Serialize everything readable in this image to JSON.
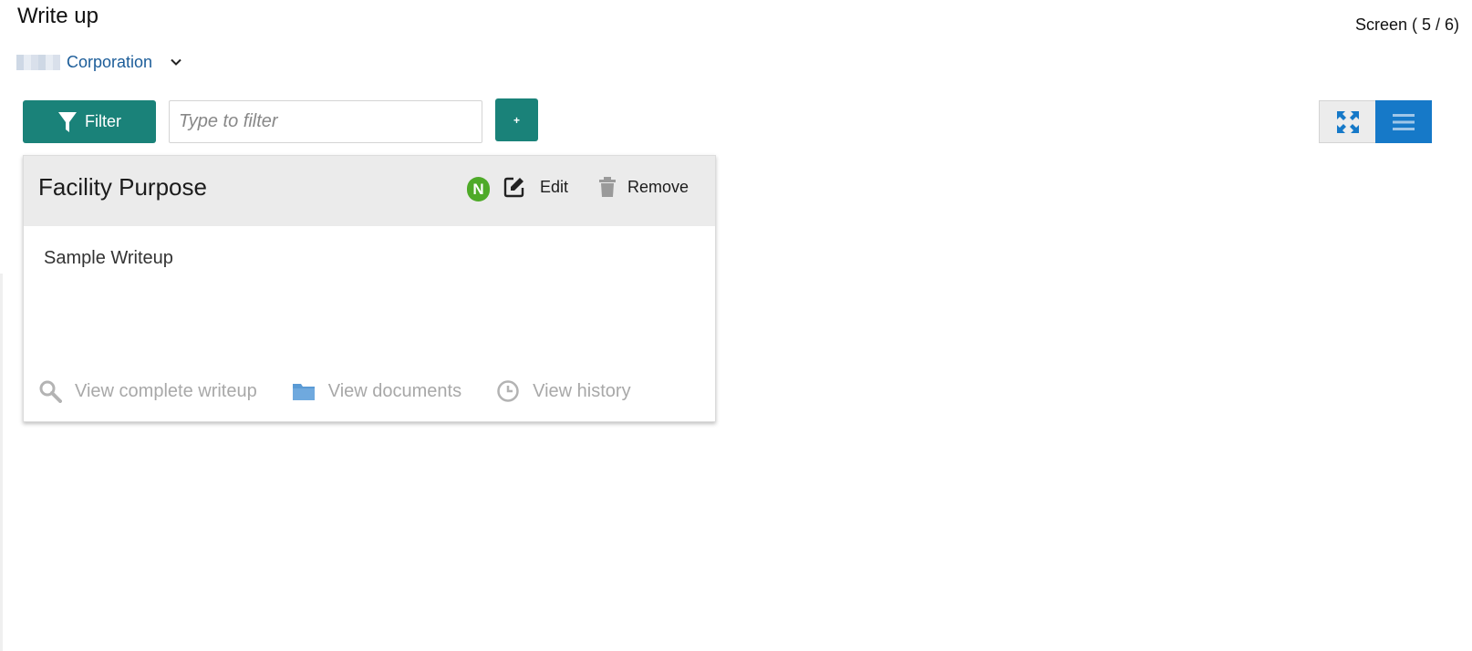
{
  "header": {
    "title": "Write up",
    "screen_indicator": "Screen ( 5 / 6)"
  },
  "party": {
    "name": "Corporation",
    "dropdown_icon": "chevron-down-icon"
  },
  "toolbar": {
    "filter_label": "Filter",
    "filter_icon": "funnel-icon",
    "filter_placeholder": "Type to filter",
    "filter_value": "",
    "add_label": "+",
    "view_tile_icon": "expand-arrows-icon",
    "view_list_icon": "hamburger-list-icon"
  },
  "card": {
    "title": "Facility Purpose",
    "status_badge": "N",
    "edit_label": "Edit",
    "remove_label": "Remove",
    "writeup": "Sample Writeup",
    "footer": {
      "view_complete_writeup": "View complete writeup",
      "view_documents": "View documents",
      "view_history": "View history"
    }
  },
  "colors": {
    "primary_teal": "#1a8279",
    "active_blue": "#1679c8",
    "badge_green": "#4eaa28",
    "link_blue": "#1c5d99",
    "muted_gray": "#a8a8a8"
  }
}
